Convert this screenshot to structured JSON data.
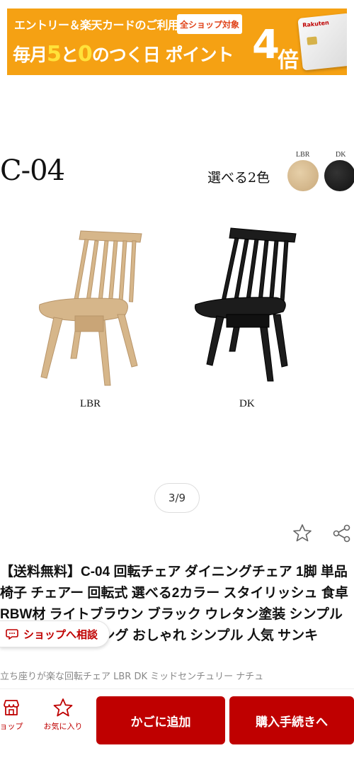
{
  "banner": {
    "line1": "エントリー＆楽天カードのご利用で",
    "chip": "全ショップ対象",
    "line2_a": "毎月",
    "line2_5": "5",
    "line2_to": "と",
    "line2_0": "0",
    "line2_b": "のつく日 ポイント",
    "big_number": "4",
    "bai": "倍",
    "card_brand": "Rakuten",
    "colors": {
      "background": "#f5a113",
      "highlight": "#ffe23a"
    }
  },
  "product_image": {
    "model": "C-04",
    "choose_colors": "選べる2色",
    "swatches": [
      {
        "label": "LBR"
      },
      {
        "label": "DK"
      }
    ],
    "chairs": [
      {
        "label": "LBR"
      },
      {
        "label": "DK"
      }
    ]
  },
  "gallery": {
    "counter": "3/9"
  },
  "item": {
    "name": "【送料無料】C-04 回転チェア ダイニングチェア 1脚 単品 椅子 チェアー 回転式 選べる2カラー スタイリッシュ 食卓 RBW材 ライトブラウン ブラック ウレタン塗装 シンプル 北欧 モダン リビング おしゃれ シンプル 人気 サンキ",
    "subtitle": "立ち座りが楽な回転チェア LBR DK ミッドセンチュリー ナチュ"
  },
  "consult_button": {
    "label": "ショップへ相談",
    "icon": "chat-bubble-icon"
  },
  "bottom_bar": {
    "shop_label": "ョップ",
    "fav_label": "お気に入り",
    "cart_button": "かごに追加",
    "buy_button": "購入手続きへ",
    "accent": "#bf0000"
  }
}
